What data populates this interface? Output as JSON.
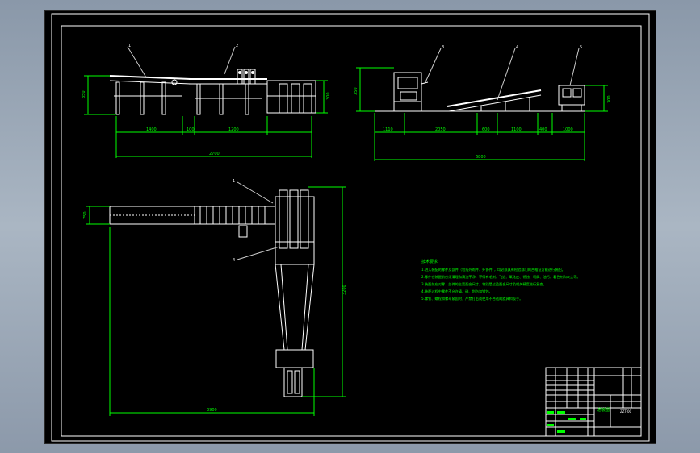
{
  "drawing": {
    "side_view_left": {
      "callouts": [
        "1",
        "2"
      ],
      "dims": {
        "height_left": "350",
        "height_right": "300",
        "seg1": "1400",
        "seg2": "100",
        "seg3": "1200",
        "total": "2700"
      }
    },
    "side_view_right": {
      "callouts": [
        "3",
        "4",
        "5"
      ],
      "dims": {
        "height_left": "350",
        "height_right": "300",
        "seg1": "1110",
        "seg2": "2050",
        "seg3": "600",
        "seg4": "1100",
        "seg5": "400",
        "seg6": "1000",
        "total": "6800"
      }
    },
    "plan_view": {
      "callouts": [
        "1",
        "4"
      ],
      "dims": {
        "width_left": "750",
        "height_right": "3200",
        "bottom_total": "3900"
      }
    },
    "notes": {
      "title": "技术要求",
      "lines": [
        "1.进入装配的零件及部件（包括外购件、外协件），均必须具有检验部门的合格证方能进行装配。",
        "2.零件在装配前必须清理和清洗干净，不得有毛刺、飞边、氧化皮、锈蚀、切屑、油污、着色剂和灰尘等。",
        "3.装配前应对零、部件的主要配合尺寸，特别是过盈配合尺寸及相关精度进行复查。",
        "4.装配过程中零件不允许磕、碰、划伤和锈蚀。",
        "5.螺钉、螺栓和螺母紧固时，严禁打击或使用不合适的旋具和扳手。"
      ]
    },
    "title_block": {
      "drawing_name": "总装图",
      "drawing_no": "ZZT-00"
    }
  },
  "colors": {
    "background": "#000000",
    "outline": "#ffffff",
    "dimension": "#00ff00",
    "leader": "#cccccc",
    "text_notes": "#00ff00"
  }
}
